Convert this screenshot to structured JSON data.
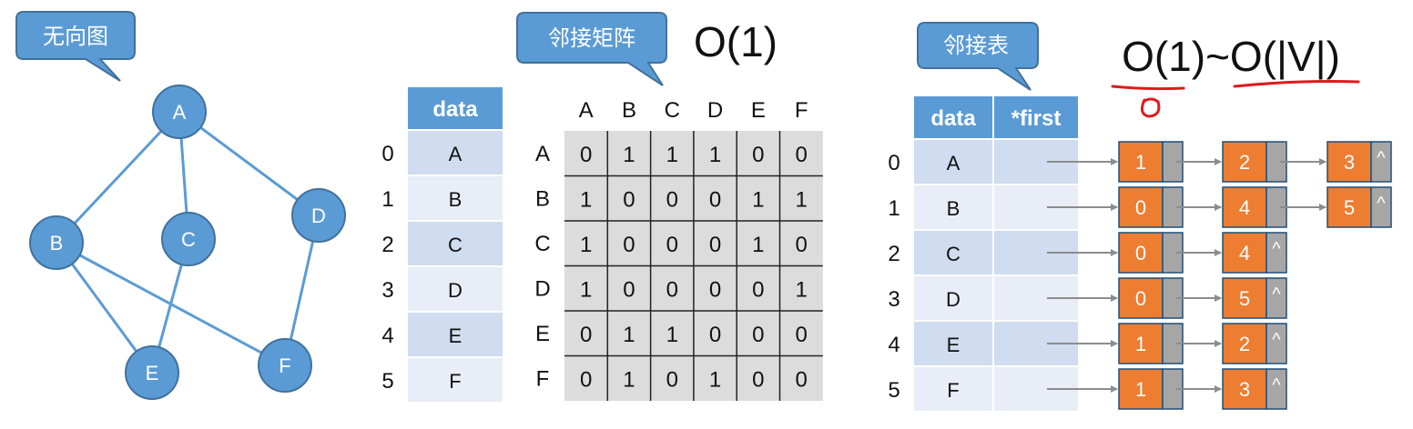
{
  "callouts": {
    "graph": "无向图",
    "matrix": "邻接矩阵",
    "list": "邻接表"
  },
  "complexity": {
    "matrix": "O(1)",
    "list": "O(1)~O(|V|)"
  },
  "graph": {
    "nodes": [
      {
        "id": "A"
      },
      {
        "id": "B"
      },
      {
        "id": "C"
      },
      {
        "id": "D"
      },
      {
        "id": "E"
      },
      {
        "id": "F"
      }
    ],
    "edges": [
      [
        "A",
        "B"
      ],
      [
        "A",
        "C"
      ],
      [
        "A",
        "D"
      ],
      [
        "B",
        "E"
      ],
      [
        "B",
        "F"
      ],
      [
        "C",
        "E"
      ],
      [
        "D",
        "F"
      ]
    ]
  },
  "vertex_table": {
    "header": "data",
    "indices": [
      "0",
      "1",
      "2",
      "3",
      "4",
      "5"
    ],
    "values": [
      "A",
      "B",
      "C",
      "D",
      "E",
      "F"
    ]
  },
  "matrix": {
    "col_labels": [
      "A",
      "B",
      "C",
      "D",
      "E",
      "F"
    ],
    "row_labels": [
      "A",
      "B",
      "C",
      "D",
      "E",
      "F"
    ],
    "cells": [
      [
        "0",
        "1",
        "1",
        "1",
        "0",
        "0"
      ],
      [
        "1",
        "0",
        "0",
        "0",
        "1",
        "1"
      ],
      [
        "1",
        "0",
        "0",
        "0",
        "1",
        "0"
      ],
      [
        "1",
        "0",
        "0",
        "0",
        "0",
        "1"
      ],
      [
        "0",
        "1",
        "1",
        "0",
        "0",
        "0"
      ],
      [
        "0",
        "1",
        "0",
        "1",
        "0",
        "0"
      ]
    ]
  },
  "adj_list": {
    "headers": [
      "data",
      "*first"
    ],
    "indices": [
      "0",
      "1",
      "2",
      "3",
      "4",
      "5"
    ],
    "values": [
      "A",
      "B",
      "C",
      "D",
      "E",
      "F"
    ],
    "chains": [
      [
        "1",
        "2",
        "3"
      ],
      [
        "0",
        "4",
        "5"
      ],
      [
        "0",
        "4"
      ],
      [
        "0",
        "5"
      ],
      [
        "1",
        "2"
      ],
      [
        "1",
        "3"
      ]
    ],
    "null_mark": "^"
  },
  "colors": {
    "node_fill": "#5b9bd5",
    "node_stroke": "#41719c",
    "edge": "#5b9bd5",
    "header_fill": "#5b9bd5",
    "row_dark": "#d0dcef",
    "row_light": "#e9edf7",
    "matrix_fill": "#dcdcdc",
    "list_node": "#ed7d31",
    "list_ptr": "#a6a6a6",
    "annotation": "#e0191d"
  }
}
